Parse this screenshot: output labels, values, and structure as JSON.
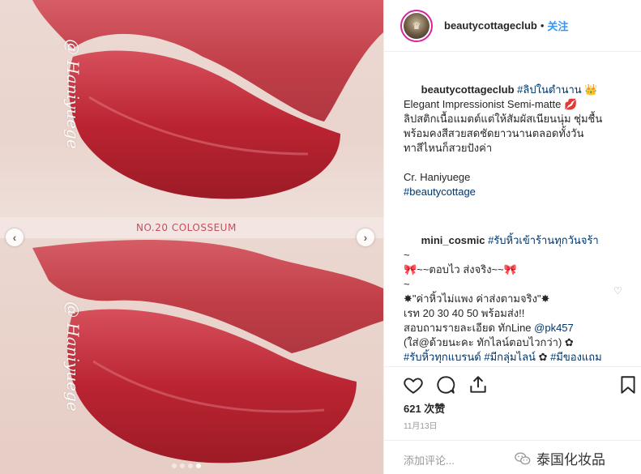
{
  "photo": {
    "shade_label": "NO.20  COLOSSEUM",
    "watermark": "@ Haniyuege",
    "prev_icon": "chevron-left-icon",
    "next_icon": "chevron-right-icon",
    "carousel": {
      "count": 4,
      "active_index": 3
    }
  },
  "header": {
    "username": "beautycottageclub",
    "separator": "•",
    "follow_label": "关注"
  },
  "comments": [
    {
      "user": "beautycottageclub",
      "text": " #ลิปในตำนาน 👑\nElegant Impressionist Semi-matte 💋ลิปสติกเนื้อแมตต์แต่ให้สัมผัสเนียนนุ่ม ชุ่มชื้น พร้อมคงสีสวยสดชัดยาวนานตลอดทั้งวัน ทาสีไหนก็สวยปังค่า\n\nCr. Haniyuege\n#beautycottage"
    },
    {
      "user": "mini_cosmic",
      "text": " #รับหิ้วเข้าร้านทุกวันจร้า\n~\n🎀~~ตอบไว ส่งจริง~~🎀\n~\n✸\"ค่าหิ้วไม่แพง ค่าส่งตามจริง\"✸\nเรท 20 30 40 50 พร้อมส่ง!!\nสอบถามรายละเอียด ทักLine @pk457\n(ใส่@ด้วยนะคะ ทักไลน์ตอบไวกว่า) ✿\n#รับหิ้วทุกแบรนด์ #มีกลุ่มไลน์ ✿ #มีของแถม #แจกรางวัล ✿ #ขอดูรีวิวร้านได้จร้า ✿ #แม่ค้าใจดีเลือกของให้เองค่ะ ✿ #ขึ้นเดียวก็รับจร้าา #ทักเลยน้าาา"
    }
  ],
  "actions": {
    "like_icon": "heart-icon",
    "comment_icon": "comment-icon",
    "share_icon": "share-icon",
    "save_icon": "bookmark-icon"
  },
  "likes": "621 次赞",
  "date": "11月13日",
  "add_comment_placeholder": "添加评论...",
  "wechat_watermark": "泰国化妆品",
  "colors": {
    "link": "#3897f0",
    "lip": "#b8242f",
    "shade_text": "#c2505e"
  }
}
